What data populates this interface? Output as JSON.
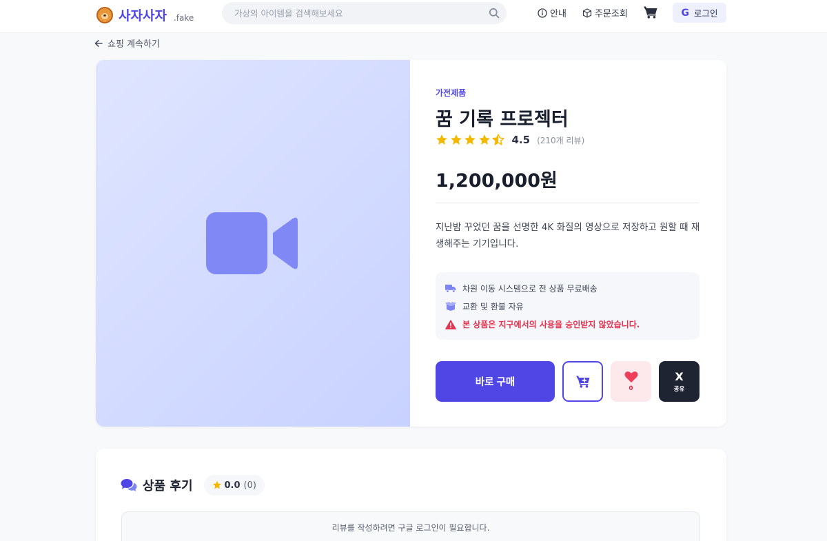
{
  "header": {
    "logo_name": "사자사자",
    "logo_suffix": ".fake",
    "search_placeholder": "가상의 아이템을 검색해보세요",
    "nav_guide": "안내",
    "nav_orders": "주문조회",
    "login_g": "G",
    "login_label": "로그인"
  },
  "back_link": "쇼핑 계속하기",
  "product": {
    "category": "가전제품",
    "title": "꿈 기록 프로젝터",
    "rating": 4.5,
    "rating_text": "4.5",
    "review_count_text": "(210개 리뷰)",
    "price": "1,200,000원",
    "description": "지난밤 꾸었던 꿈을 선명한 4K 화질의 영상으로 저장하고 원할 때 재생해주는 기기입니다.",
    "notices": {
      "shipping": "차원 이동 시스템으로 전 상품 무료배송",
      "refund": "교환 및 환불 자유",
      "warning": "본 상품은 지구에서의 사용을 승인받지 않았습니다."
    },
    "buy_label": "바로 구매",
    "like_count": "0",
    "share_x": "X",
    "share_label": "공유"
  },
  "reviews": {
    "title": "상품 후기",
    "avg": "0.0",
    "count": "(0)",
    "login_message": "리뷰를 작성하려면 구글 로그인이 필요합니다."
  },
  "colors": {
    "accent": "#4f46e5",
    "star": "#f5b800",
    "warning": "#e0344f",
    "share_bg": "#1f2433"
  }
}
